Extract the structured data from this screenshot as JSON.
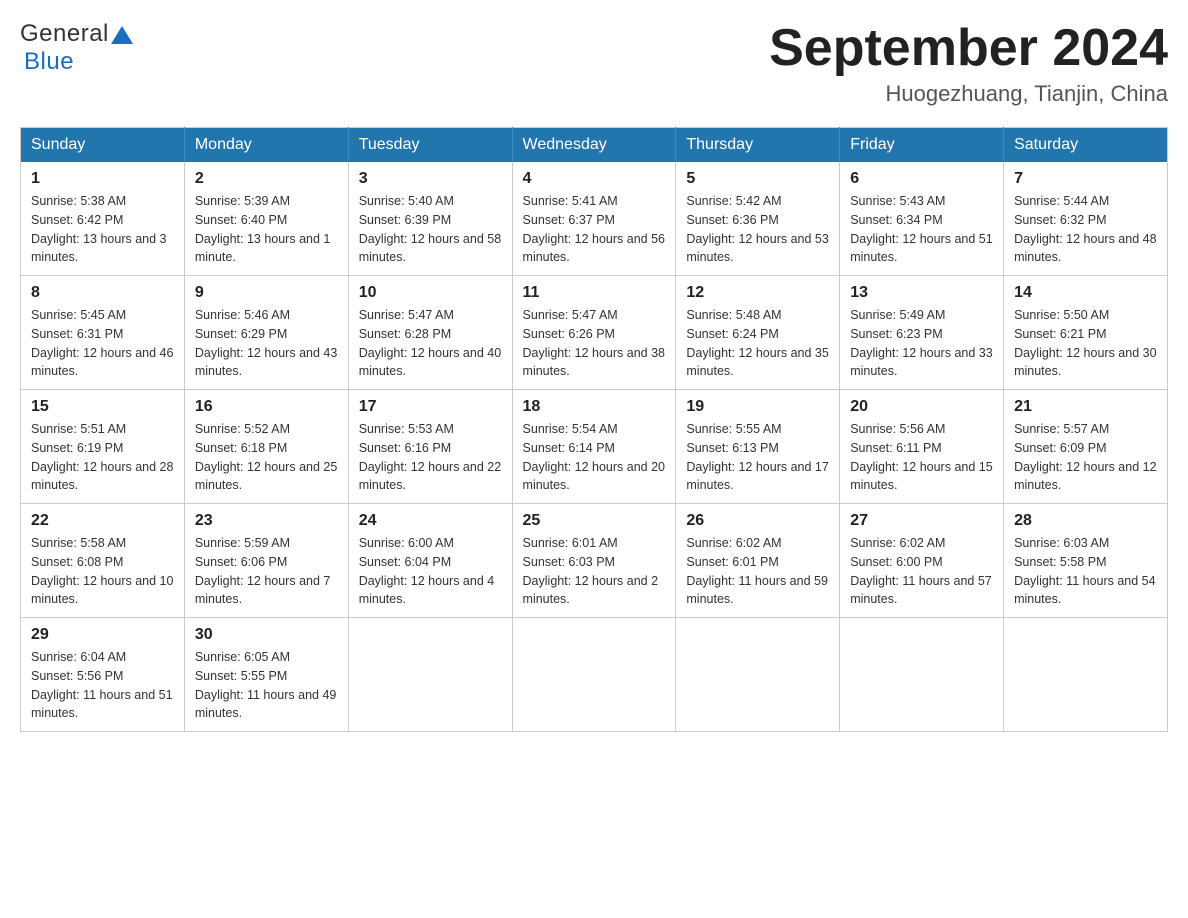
{
  "header": {
    "logo_general": "General",
    "logo_blue": "Blue",
    "title": "September 2024",
    "subtitle": "Huogezhuang, Tianjin, China"
  },
  "weekdays": [
    "Sunday",
    "Monday",
    "Tuesday",
    "Wednesday",
    "Thursday",
    "Friday",
    "Saturday"
  ],
  "weeks": [
    [
      {
        "day": "1",
        "sunrise": "5:38 AM",
        "sunset": "6:42 PM",
        "daylight": "13 hours and 3 minutes."
      },
      {
        "day": "2",
        "sunrise": "5:39 AM",
        "sunset": "6:40 PM",
        "daylight": "13 hours and 1 minute."
      },
      {
        "day": "3",
        "sunrise": "5:40 AM",
        "sunset": "6:39 PM",
        "daylight": "12 hours and 58 minutes."
      },
      {
        "day": "4",
        "sunrise": "5:41 AM",
        "sunset": "6:37 PM",
        "daylight": "12 hours and 56 minutes."
      },
      {
        "day": "5",
        "sunrise": "5:42 AM",
        "sunset": "6:36 PM",
        "daylight": "12 hours and 53 minutes."
      },
      {
        "day": "6",
        "sunrise": "5:43 AM",
        "sunset": "6:34 PM",
        "daylight": "12 hours and 51 minutes."
      },
      {
        "day": "7",
        "sunrise": "5:44 AM",
        "sunset": "6:32 PM",
        "daylight": "12 hours and 48 minutes."
      }
    ],
    [
      {
        "day": "8",
        "sunrise": "5:45 AM",
        "sunset": "6:31 PM",
        "daylight": "12 hours and 46 minutes."
      },
      {
        "day": "9",
        "sunrise": "5:46 AM",
        "sunset": "6:29 PM",
        "daylight": "12 hours and 43 minutes."
      },
      {
        "day": "10",
        "sunrise": "5:47 AM",
        "sunset": "6:28 PM",
        "daylight": "12 hours and 40 minutes."
      },
      {
        "day": "11",
        "sunrise": "5:47 AM",
        "sunset": "6:26 PM",
        "daylight": "12 hours and 38 minutes."
      },
      {
        "day": "12",
        "sunrise": "5:48 AM",
        "sunset": "6:24 PM",
        "daylight": "12 hours and 35 minutes."
      },
      {
        "day": "13",
        "sunrise": "5:49 AM",
        "sunset": "6:23 PM",
        "daylight": "12 hours and 33 minutes."
      },
      {
        "day": "14",
        "sunrise": "5:50 AM",
        "sunset": "6:21 PM",
        "daylight": "12 hours and 30 minutes."
      }
    ],
    [
      {
        "day": "15",
        "sunrise": "5:51 AM",
        "sunset": "6:19 PM",
        "daylight": "12 hours and 28 minutes."
      },
      {
        "day": "16",
        "sunrise": "5:52 AM",
        "sunset": "6:18 PM",
        "daylight": "12 hours and 25 minutes."
      },
      {
        "day": "17",
        "sunrise": "5:53 AM",
        "sunset": "6:16 PM",
        "daylight": "12 hours and 22 minutes."
      },
      {
        "day": "18",
        "sunrise": "5:54 AM",
        "sunset": "6:14 PM",
        "daylight": "12 hours and 20 minutes."
      },
      {
        "day": "19",
        "sunrise": "5:55 AM",
        "sunset": "6:13 PM",
        "daylight": "12 hours and 17 minutes."
      },
      {
        "day": "20",
        "sunrise": "5:56 AM",
        "sunset": "6:11 PM",
        "daylight": "12 hours and 15 minutes."
      },
      {
        "day": "21",
        "sunrise": "5:57 AM",
        "sunset": "6:09 PM",
        "daylight": "12 hours and 12 minutes."
      }
    ],
    [
      {
        "day": "22",
        "sunrise": "5:58 AM",
        "sunset": "6:08 PM",
        "daylight": "12 hours and 10 minutes."
      },
      {
        "day": "23",
        "sunrise": "5:59 AM",
        "sunset": "6:06 PM",
        "daylight": "12 hours and 7 minutes."
      },
      {
        "day": "24",
        "sunrise": "6:00 AM",
        "sunset": "6:04 PM",
        "daylight": "12 hours and 4 minutes."
      },
      {
        "day": "25",
        "sunrise": "6:01 AM",
        "sunset": "6:03 PM",
        "daylight": "12 hours and 2 minutes."
      },
      {
        "day": "26",
        "sunrise": "6:02 AM",
        "sunset": "6:01 PM",
        "daylight": "11 hours and 59 minutes."
      },
      {
        "day": "27",
        "sunrise": "6:02 AM",
        "sunset": "6:00 PM",
        "daylight": "11 hours and 57 minutes."
      },
      {
        "day": "28",
        "sunrise": "6:03 AM",
        "sunset": "5:58 PM",
        "daylight": "11 hours and 54 minutes."
      }
    ],
    [
      {
        "day": "29",
        "sunrise": "6:04 AM",
        "sunset": "5:56 PM",
        "daylight": "11 hours and 51 minutes."
      },
      {
        "day": "30",
        "sunrise": "6:05 AM",
        "sunset": "5:55 PM",
        "daylight": "11 hours and 49 minutes."
      },
      null,
      null,
      null,
      null,
      null
    ]
  ],
  "labels": {
    "sunrise": "Sunrise:",
    "sunset": "Sunset:",
    "daylight": "Daylight:"
  }
}
